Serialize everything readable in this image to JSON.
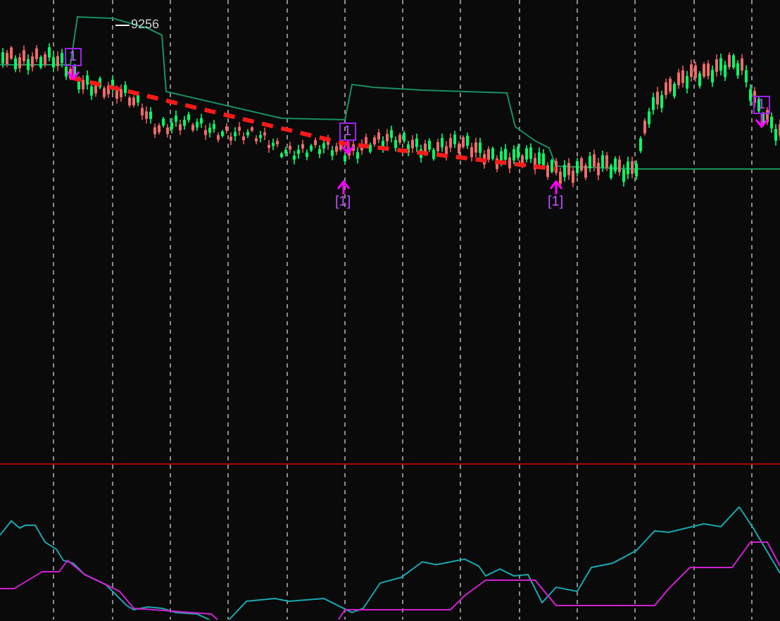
{
  "price_chart": {
    "price_label": "9256",
    "signals": [
      {
        "kind": "sell",
        "label": "1"
      },
      {
        "kind": "sell",
        "label": "1"
      },
      {
        "kind": "sell",
        "label": "1"
      },
      {
        "kind": "buy",
        "label": "[1]"
      },
      {
        "kind": "buy",
        "label": "[1]"
      }
    ]
  }
}
